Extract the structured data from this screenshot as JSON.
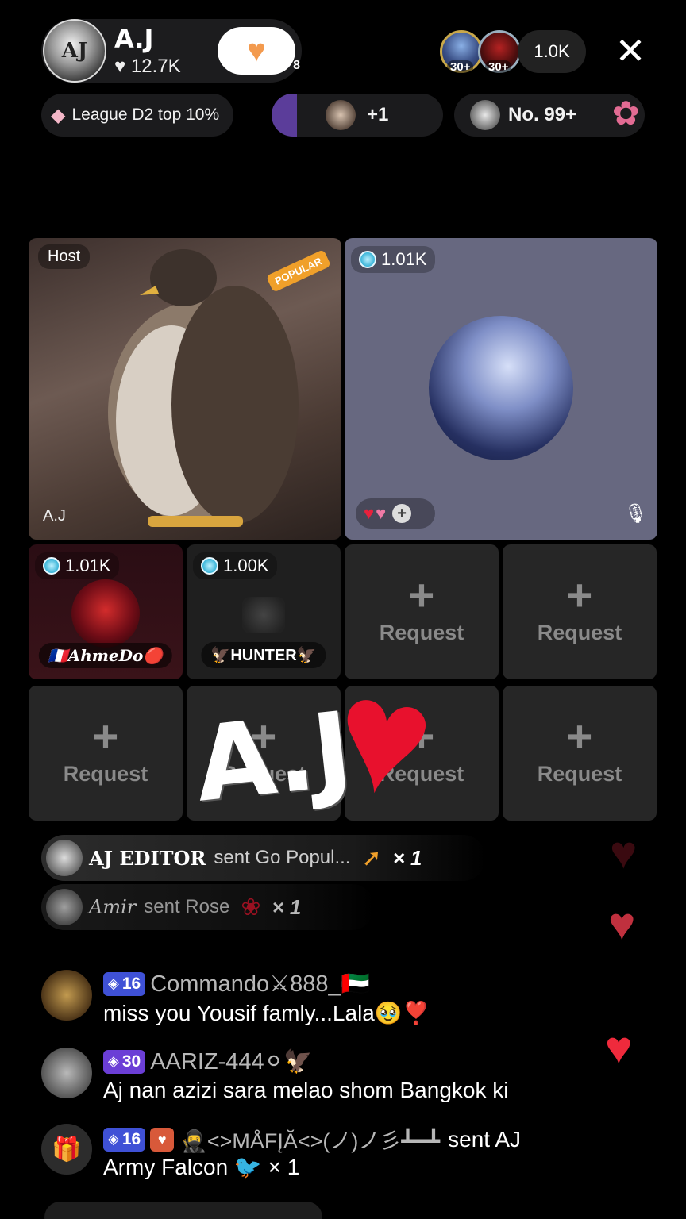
{
  "header": {
    "host_avatar_text": "AJ",
    "host_name": "A.J",
    "host_likes": "♥ 12.7K",
    "follow_badge": "8",
    "viewer_levels": [
      "30+",
      "30+"
    ],
    "viewer_count": "1.0K",
    "close_icon": "close-icon"
  },
  "chips": {
    "league": "League D2 top 10%",
    "rank_up": "+1",
    "number": "No. 99+"
  },
  "host_tile": {
    "tag": "Host",
    "badge": "POPULAR",
    "name": "A.J"
  },
  "guest_tile": {
    "coins": "1.01K"
  },
  "seats": [
    {
      "coins": "1.01K",
      "name": "🇫🇷AhmeDo🔴"
    },
    {
      "coins": "1.00K",
      "name": "🦅HUNTER🦅"
    }
  ],
  "request": {
    "plus": "+",
    "label": "Request"
  },
  "overlay": {
    "text": "A.J"
  },
  "gift_banners": [
    {
      "sender": "AJ EDITOR",
      "action": "sent Go Popul...",
      "count": "× 1"
    },
    {
      "sender": "Amir",
      "action": "sent Rose",
      "count": "× 1"
    }
  ],
  "comments": [
    {
      "level": "16",
      "user": "Commando⚔888_🇦🇪",
      "text": "miss you Yousif famly...Lala🥹❣️"
    },
    {
      "level": "30",
      "user": "AARIZ-444⚪🦅",
      "text": "Aj nan azizi sara melao shom Bangkok ki"
    },
    {
      "level": "16",
      "user": "🥷<>MÅFĮĂ<>(ノ)ノ彡┻━┻",
      "action": "sent AJ",
      "text": "Army Falcon 🐦 × 1"
    }
  ],
  "colors": {
    "background": "#000000",
    "accent_heart": "#e8112d",
    "level_blue": "#3f51d6",
    "level_purple": "#6b3ed6",
    "guest_tile": "#676880"
  }
}
